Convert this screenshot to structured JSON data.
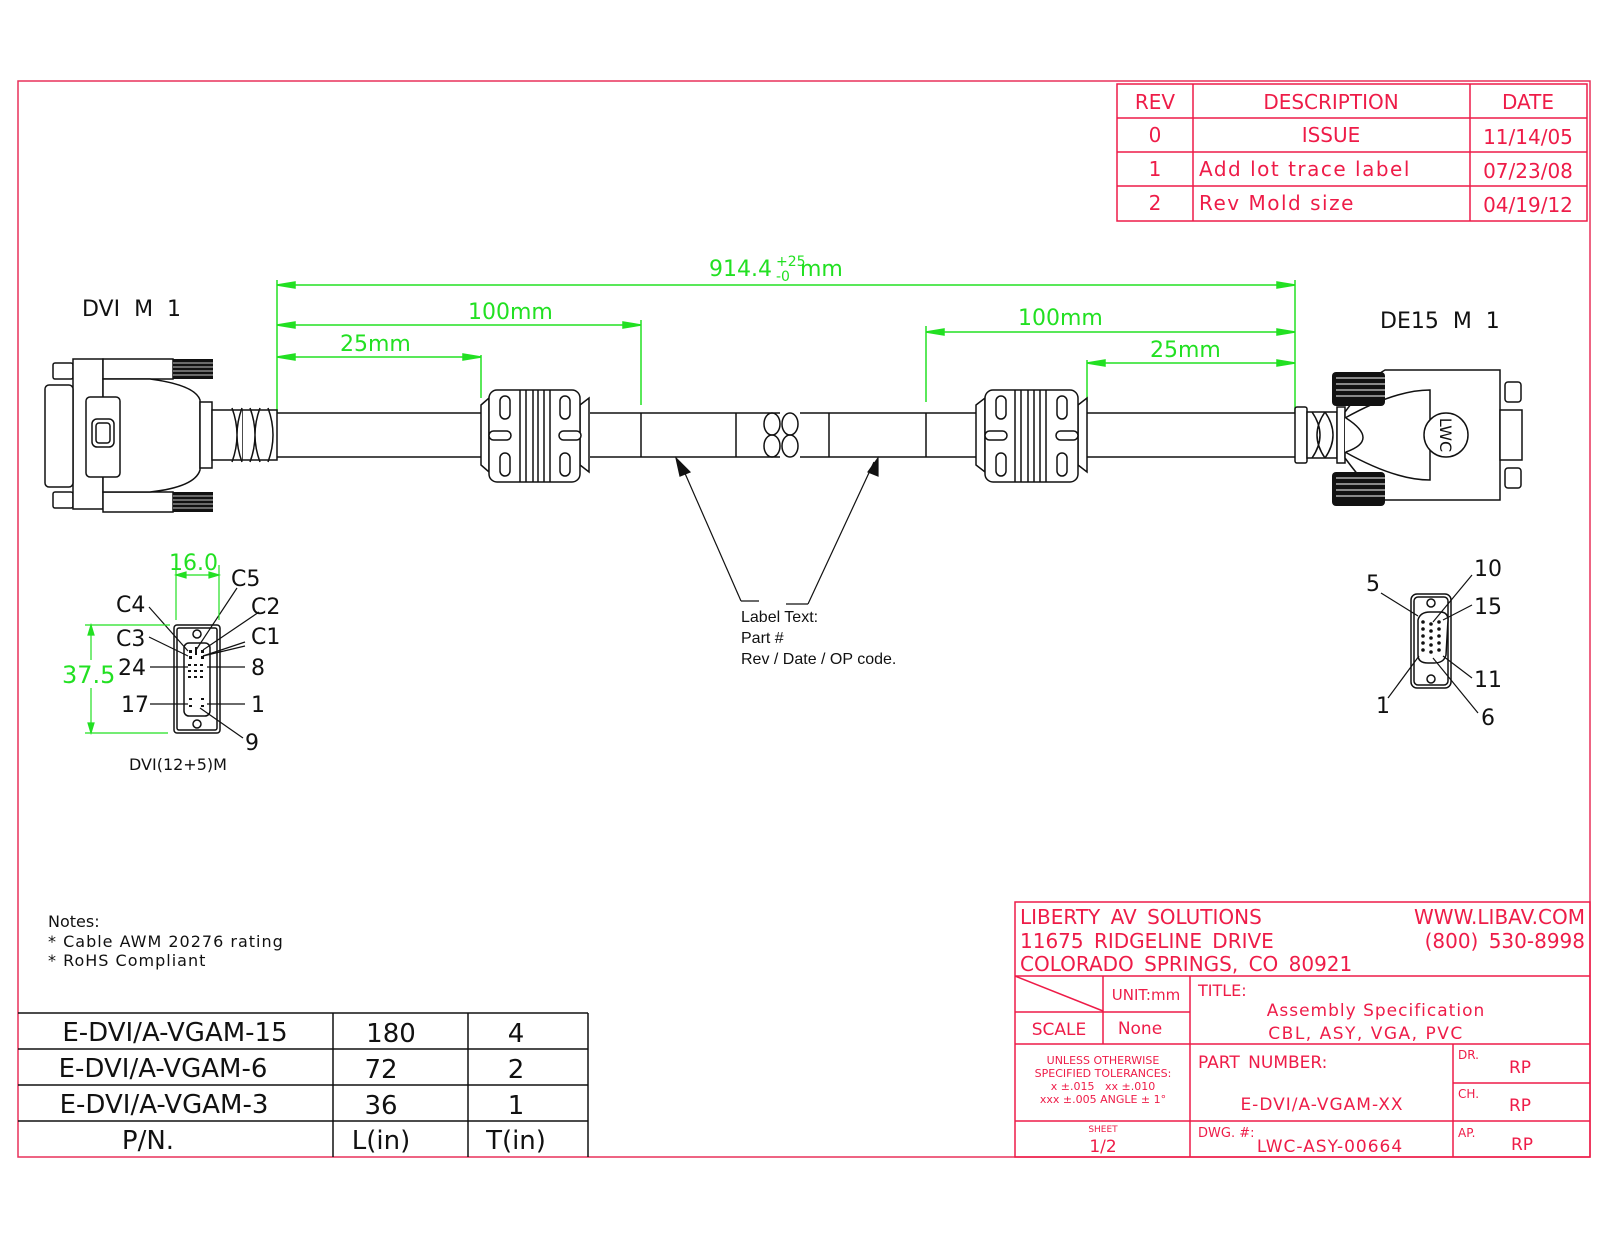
{
  "colors": {
    "border": "#e8305a",
    "title_block": "#ee1c48",
    "dimension": "#22e022",
    "drawing": "#111111"
  },
  "revision_table": {
    "headers": [
      "REV",
      "DESCRIPTION",
      "DATE"
    ],
    "rows": [
      {
        "rev": "0",
        "description": "ISSUE",
        "date": "11/14/05"
      },
      {
        "rev": "1",
        "description": "Add lot trace label",
        "date": "07/23/08"
      },
      {
        "rev": "2",
        "description": "Rev Mold size",
        "date": "04/19/12"
      }
    ]
  },
  "connectors": {
    "left": {
      "label": "DVI  M  1"
    },
    "right": {
      "label": "DE15  M  1",
      "logo": "LWC"
    }
  },
  "dimensions": {
    "overall": {
      "value": "914.4",
      "tol_plus": "+25",
      "tol_minus": "-0",
      "unit": "mm"
    },
    "left_100": "100mm",
    "left_25": "25mm",
    "right_100": "100mm",
    "right_25": "25mm"
  },
  "label_callout": {
    "lines": [
      "Label Text:",
      "Part #",
      "Rev / Date / OP code."
    ]
  },
  "dvi_pinout": {
    "width_dim": "16.0",
    "height_dim": "37.5",
    "pins": [
      "C5",
      "C4",
      "C2",
      "C3",
      "C1",
      "24",
      "8",
      "17",
      "1",
      "9"
    ],
    "caption": "DVI(12+5)M"
  },
  "vga_pinout": {
    "pins": [
      "5",
      "10",
      "15",
      "11",
      "1",
      "6"
    ]
  },
  "notes": {
    "title": "Notes:",
    "items": [
      "* Cable AWM 20276 rating",
      "* RoHS Compliant"
    ]
  },
  "part_table": {
    "headers": [
      "P/N.",
      "L(in)",
      "T(in)"
    ],
    "rows": [
      {
        "pn": "E-DVI/A-VGAM-15",
        "l": "180",
        "t": "4"
      },
      {
        "pn": "E-DVI/A-VGAM-6",
        "l": "72",
        "t": "2"
      },
      {
        "pn": "E-DVI/A-VGAM-3",
        "l": "36",
        "t": "1"
      }
    ]
  },
  "title_block": {
    "company": "LIBERTY AV SOLUTIONS",
    "address1": "11675 RIDGELINE DRIVE",
    "address2": "COLORADO SPRINGS, CO 80921",
    "website": "WWW.LIBAV.COM",
    "phone": "(800) 530-8998",
    "unit_label": "UNIT:mm",
    "scale_label": "SCALE",
    "scale_value": "None",
    "title_label": "TITLE:",
    "title_line1": "Assembly Specification",
    "title_line2": "CBL, ASY, VGA, PVC",
    "tolerances": [
      "UNLESS OTHERWISE",
      "SPECIFIED TOLERANCES:",
      "x ±.015   xx ±.010",
      "xxx ±.005 ANGLE ± 1°"
    ],
    "part_number_label": "PART NUMBER:",
    "part_number": "E-DVI/A-VGAM-XX",
    "sheet_label": "SHEET",
    "sheet_value": "1/2",
    "dwg_label": "DWG. #:",
    "dwg_number": "LWC-ASY-00664",
    "dr_label": "DR.",
    "dr_value": "RP",
    "ch_label": "CH.",
    "ch_value": "RP",
    "ap_label": "AP.",
    "ap_value": "RP"
  }
}
